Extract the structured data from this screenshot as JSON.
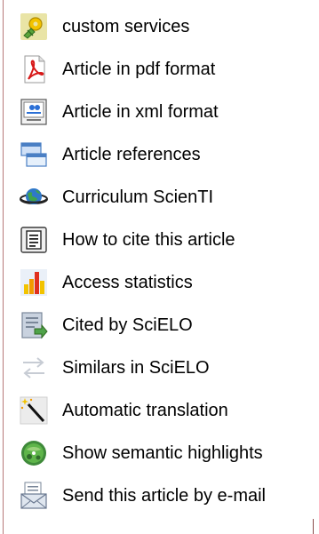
{
  "menu": {
    "items": [
      {
        "label": "custom services",
        "icon": "services-icon"
      },
      {
        "label": "Article in pdf format",
        "icon": "pdf-icon"
      },
      {
        "label": "Article in xml format",
        "icon": "xml-icon"
      },
      {
        "label": "Article references",
        "icon": "references-icon"
      },
      {
        "label": "Curriculum ScienTI",
        "icon": "globe-icon"
      },
      {
        "label": "How to cite this article",
        "icon": "document-icon"
      },
      {
        "label": "Access statistics",
        "icon": "bar-chart-icon"
      },
      {
        "label": "Cited by SciELO",
        "icon": "cited-icon"
      },
      {
        "label": "Similars in SciELO",
        "icon": "arrows-icon"
      },
      {
        "label": "Automatic translation",
        "icon": "magic-wand-icon"
      },
      {
        "label": "Show semantic highlights",
        "icon": "semantic-icon"
      },
      {
        "label": "Send this article by e-mail",
        "icon": "email-icon"
      }
    ]
  },
  "colors": {
    "border": "#b77a7a",
    "text": "#000000"
  }
}
